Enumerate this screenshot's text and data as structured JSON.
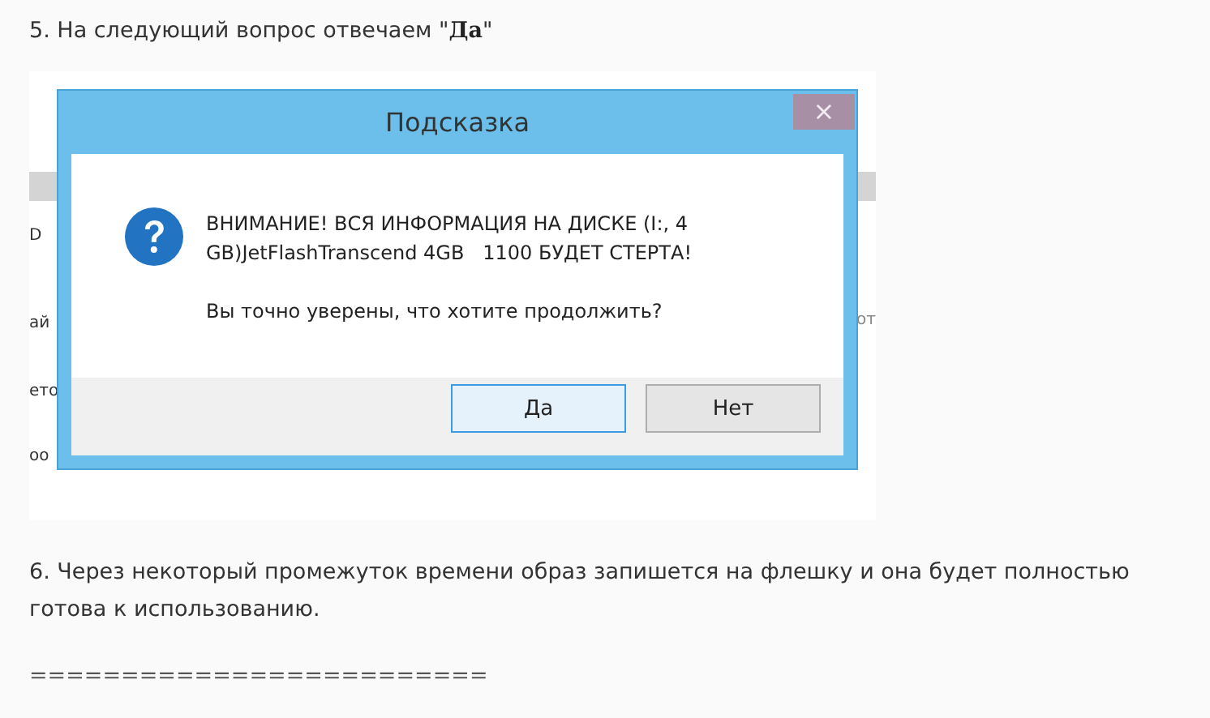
{
  "step_before": {
    "number": "5.",
    "text": "На следующий вопрос отвечаем \"**Да**\""
  },
  "screenshot": {
    "background_fragments": [
      {
        "text": "D",
        "kind": "left"
      },
      {
        "text": "ай",
        "kind": "left"
      },
      {
        "text": "ето",
        "kind": "left"
      },
      {
        "text": "оо",
        "kind": "left"
      },
      {
        "text": "от",
        "kind": "right"
      }
    ],
    "dialog": {
      "title": "Подсказка",
      "close": "×",
      "message": "ВНИМАНИЕ! ВСЯ ИНФОРМАЦИЯ НА ДИСКЕ (I:, 4 GB)JetFlashTranscend 4GB   1100 БУДЕТ СТЕРТА!",
      "question": "Вы точно уверены, что хотите продолжить?",
      "buttons": [
        {
          "label": "Да",
          "selected": true
        },
        {
          "label": "Нет",
          "selected": false
        }
      ]
    }
  },
  "step_after": {
    "number": "6.",
    "text": "Через некоторый промежуток времени образ запишется на флешку и она будет полностью готова к использованию."
  },
  "separator": "========================="
}
